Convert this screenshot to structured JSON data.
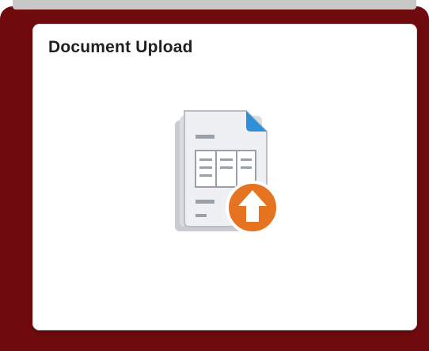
{
  "tile": {
    "title": "Document Upload",
    "icon": "document-upload-icon"
  },
  "colors": {
    "frame": "#6f0a0f",
    "tile_background": "#ffffff",
    "icon_accent_blue": "#2f8fd8",
    "icon_accent_orange": "#e6731f"
  }
}
